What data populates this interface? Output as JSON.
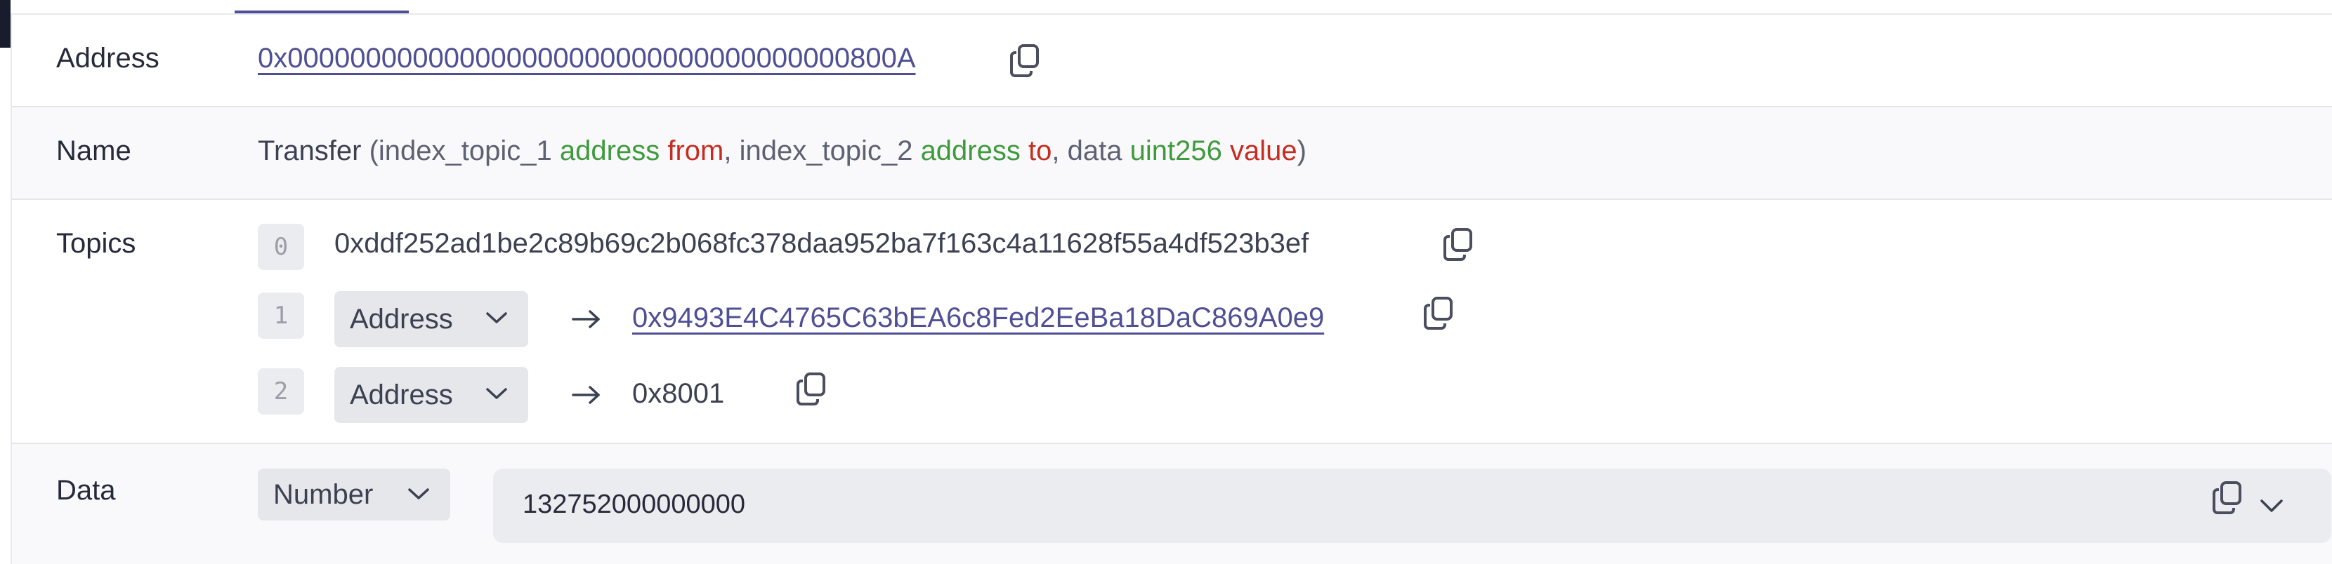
{
  "rows": {
    "address": {
      "label": "Address",
      "value": "0x000000000000000000000000000000000000800A"
    },
    "name": {
      "label": "Name",
      "event": "Transfer",
      "open_paren": "(",
      "p1_index": "index_topic_1",
      "p1_type": "address",
      "p1_name": "from",
      "sep1": ",",
      "p2_index": "index_topic_2",
      "p2_type": "address",
      "p2_name": "to",
      "sep2": ",",
      "p3_index": "data",
      "p3_type": "uint256",
      "p3_name": "value",
      "close_paren": ")"
    },
    "topics": {
      "label": "Topics",
      "items": [
        {
          "index": "0",
          "value": "0xddf252ad1be2c89b69c2b068fc378daa952ba7f163c4a11628f55a4df523b3ef"
        },
        {
          "index": "1",
          "format": "Address",
          "value": "0x9493E4C4765C63bEA6c8Fed2EeBa18DaC869A0e9"
        },
        {
          "index": "2",
          "format": "Address",
          "value": "0x8001"
        }
      ]
    },
    "data": {
      "label": "Data",
      "format": "Number",
      "value": "132752000000000"
    }
  },
  "icons": {
    "copy": "copy-icon",
    "chevron": "chevron-down-icon",
    "arrow": "arrow-right-icon"
  },
  "colors": {
    "link": "#4f4f96",
    "type": "#3f9a3d",
    "variable": "#c52d21",
    "text": "#262a3b"
  }
}
